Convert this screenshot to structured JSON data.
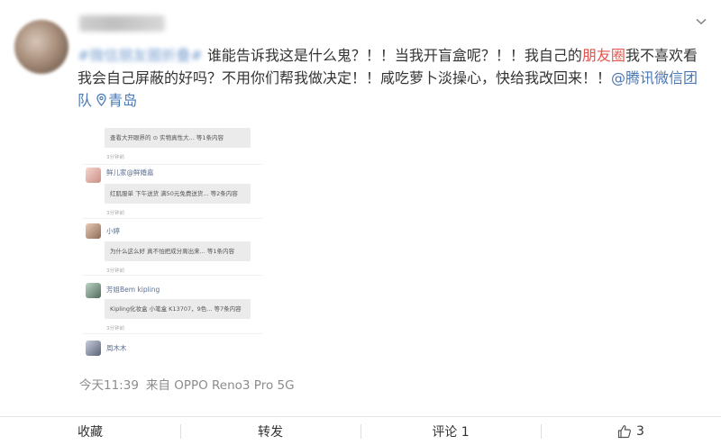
{
  "post": {
    "hashtag": "#微信朋友圈折叠#",
    "text_1": " 谁能告诉我这是什么鬼？！！当我开盲盒呢？！！我自己的",
    "highlight": "朋友圈",
    "text_2": "我不喜欢看我会自己屏蔽的好吗？不用你们帮我做决定！！咸吃萝卜淡操心，快给我改回来！！",
    "mention": "@腾讯微信团队",
    "location": "青岛"
  },
  "screenshot": {
    "items": [
      {
        "name": "",
        "content": "查看大开眼界的 ⊙ 实物真性大...  等1条内容",
        "time": "3分钟前"
      },
      {
        "name": "鲜儿家@鲜婚嘉",
        "content": "红肌服单 下午送货 满50元免费送货...  等2条内容",
        "time": "3分钟前"
      },
      {
        "name": "小婷",
        "content": "为什么这么好 真不怕把成分离出来...  等1条内容",
        "time": "3分钟前"
      },
      {
        "name": "芳姐Bem kipling",
        "content": "Kipling化妆盒 小笔盒 K13707，9色...  等7条内容",
        "time": "3分钟前"
      },
      {
        "name": "周木木",
        "content": "",
        "time": ""
      }
    ]
  },
  "meta": {
    "time": "今天11:39",
    "source": "来自 OPPO Reno3 Pro 5G"
  },
  "actions": {
    "favorite": "收藏",
    "repost": "转发",
    "comment": "评论 1",
    "like_count": "3"
  },
  "icons": {
    "chevron": "chevron-down-icon",
    "location": "location-pin-icon",
    "like": "thumbs-up-icon"
  },
  "colors": {
    "link": "#4a78b5",
    "highlight": "#e5524a",
    "meta": "#8c8c8c"
  }
}
